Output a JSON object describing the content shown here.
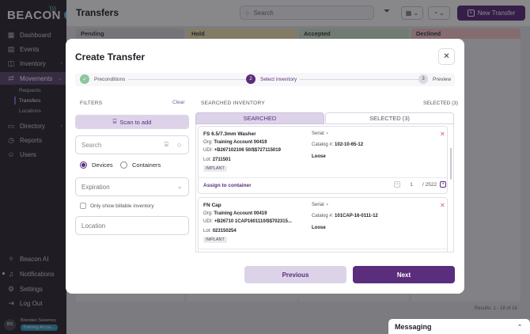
{
  "app": {
    "logo_text": "BEACON"
  },
  "header": {
    "title": "Transfers",
    "search_placeholder": "Search",
    "new_transfer_label": "New Transfer"
  },
  "sidebar": {
    "items": [
      {
        "label": "Dashboard",
        "icon": "grid-icon"
      },
      {
        "label": "Events",
        "icon": "calendar-icon"
      },
      {
        "label": "Inventory",
        "icon": "box-icon"
      },
      {
        "label": "Movements",
        "icon": "arrows-icon"
      },
      {
        "label": "Directory",
        "icon": "folder-icon"
      },
      {
        "label": "Reports",
        "icon": "clock-icon"
      },
      {
        "label": "Users",
        "icon": "user-icon"
      }
    ],
    "sub_items": [
      "Requests",
      "Transfers",
      "Locations"
    ],
    "bottom_items": [
      {
        "label": "Beacon AI",
        "icon": "sparkle-icon"
      },
      {
        "label": "Notifications",
        "icon": "bell-icon"
      },
      {
        "label": "Settings",
        "icon": "gear-icon"
      },
      {
        "label": "Log Out",
        "icon": "logout-icon"
      }
    ],
    "user": {
      "initials": "BS",
      "name": "Brendan Sweeney",
      "account": "Training Accou..."
    }
  },
  "board": {
    "columns": [
      {
        "label": "Pending",
        "color": "#d9dadd"
      },
      {
        "label": "Hold",
        "color": "#f3e6b6"
      },
      {
        "label": "Accepted",
        "color": "#cfe9cf"
      },
      {
        "label": "Declined",
        "color": "#f6c9ca"
      }
    ],
    "results_text": "Results: 1 - 18 of 18",
    "messaging_label": "Messaging"
  },
  "modal": {
    "title": "Create Transfer",
    "steps": [
      {
        "num": "✓",
        "label": "Preconditions",
        "state": "done"
      },
      {
        "num": "2",
        "label": "Select inventory",
        "state": "current"
      },
      {
        "num": "3",
        "label": "Preview",
        "state": "todo"
      }
    ],
    "filters": {
      "label": "FILTERS",
      "clear": "Clear",
      "scan_label": "Scan to add",
      "search_placeholder": "Search",
      "radio_devices": "Devices",
      "radio_containers": "Containers",
      "selected_radio": "Devices",
      "expiration_placeholder": "Expiration",
      "billable_label": "Only show billable inventory",
      "location_placeholder": "Location"
    },
    "inventory": {
      "label": "SEARCHED INVENTORY",
      "selected_count": "SELECTED (3)",
      "tab_searched": "SEARCHED",
      "tab_selected": "SELECTED (3)",
      "items": [
        {
          "name": "FS 6.5/7.3mm Washer",
          "org_label": "Org:",
          "org": "Training Account 00419",
          "udi_label": "UDI:",
          "udi": "+B267102106 50/$$727115019",
          "lot_label": "Lot:",
          "lot": "2711501",
          "badge": "IMPLANT",
          "serial_label": "Serial:",
          "serial": "-",
          "catalog_label": "Catalog #:",
          "catalog": "102-10-65-12",
          "status": "Loose",
          "assign": "Assign to container",
          "qty": "1",
          "qty_max": "/ 2522"
        },
        {
          "name": "FN Cap",
          "org_label": "Org:",
          "org": "Training Account 00419",
          "udi_label": "UDI:",
          "udi": "+B26710 1CAP1601110/$$702315...",
          "lot_label": "Lot:",
          "lot": "023150254",
          "badge": "IMPLANT",
          "serial_label": "Serial:",
          "serial": "-",
          "catalog_label": "Catalog #:",
          "catalog": "101CAP-16-0111-12",
          "status": "Loose"
        }
      ]
    },
    "buttons": {
      "previous": "Previous",
      "next": "Next"
    }
  },
  "colors": {
    "accent": "#5a2d7d",
    "sidebar_bg": "#2c2a31",
    "active_nav": "#5a4a70",
    "account_badge": "#3a9bc2"
  }
}
